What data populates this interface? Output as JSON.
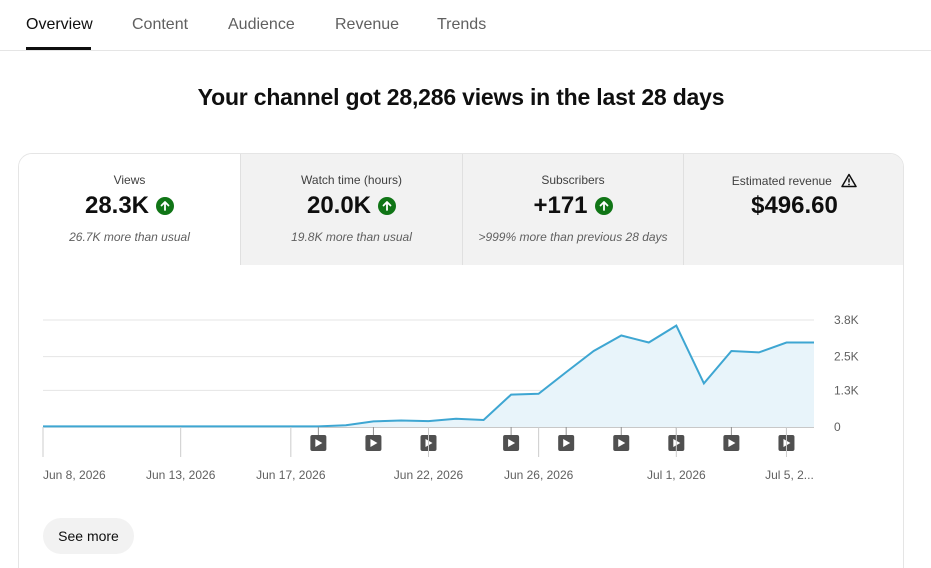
{
  "tabs": [
    {
      "label": "Overview",
      "active": true
    },
    {
      "label": "Content",
      "active": false
    },
    {
      "label": "Audience",
      "active": false
    },
    {
      "label": "Revenue",
      "active": false
    },
    {
      "label": "Trends",
      "active": false
    }
  ],
  "headline": "Your channel got 28,286 views in the last 28 days",
  "metrics": [
    {
      "label": "Views",
      "value": "28.3K",
      "sub": "26.7K more than usual",
      "selected": true,
      "icon": "arrow-up-icon"
    },
    {
      "label": "Watch time (hours)",
      "value": "20.0K",
      "sub": "19.8K more than usual",
      "selected": false,
      "icon": "arrow-up-icon"
    },
    {
      "label": "Subscribers",
      "value": "+171",
      "sub": ">999% more than previous 28 days",
      "selected": false,
      "icon": "arrow-up-icon"
    },
    {
      "label": "Estimated revenue",
      "value": "$496.60",
      "sub": "",
      "selected": false,
      "icon": "warning-icon"
    }
  ],
  "see_more": "See more",
  "colors": {
    "accent_line": "#3ea6d2",
    "fill": "#e8f4fa",
    "up_green": "#107516"
  },
  "chart_data": {
    "type": "area",
    "y_ticks": [
      "3.8K",
      "2.5K",
      "1.3K",
      "0"
    ],
    "y_tick_values": [
      3800,
      2500,
      1300,
      0
    ],
    "ylim": [
      0,
      3800
    ],
    "x_tick_labels": [
      "Jun 8, 2026",
      "Jun 13, 2026",
      "Jun 17, 2026",
      "Jun 22, 2026",
      "Jun 26, 2026",
      "Jul 1, 2026",
      "Jul 5, 2..."
    ],
    "x": [
      "Jun 8",
      "Jun 9",
      "Jun 10",
      "Jun 11",
      "Jun 12",
      "Jun 13",
      "Jun 14",
      "Jun 15",
      "Jun 16",
      "Jun 17",
      "Jun 18",
      "Jun 19",
      "Jun 20",
      "Jun 21",
      "Jun 22",
      "Jun 23",
      "Jun 24",
      "Jun 25",
      "Jun 26",
      "Jun 27",
      "Jun 28",
      "Jun 29",
      "Jun 30",
      "Jul 1",
      "Jul 2",
      "Jul 3",
      "Jul 4",
      "Jul 5",
      "Jul 6"
    ],
    "series": [
      {
        "values": [
          20,
          20,
          20,
          20,
          20,
          20,
          20,
          20,
          20,
          20,
          20,
          60,
          200,
          230,
          210,
          290,
          250,
          1150,
          1180,
          1950,
          2700,
          3250,
          3000,
          3600,
          1550,
          2700,
          2650,
          3000,
          3000
        ]
      }
    ],
    "video_markers": [
      "Jun 18",
      "Jun 20",
      "Jun 22",
      "Jun 25",
      "Jun 27",
      "Jun 29",
      "Jul 1",
      "Jul 3",
      "Jul 5"
    ],
    "grid": true
  }
}
